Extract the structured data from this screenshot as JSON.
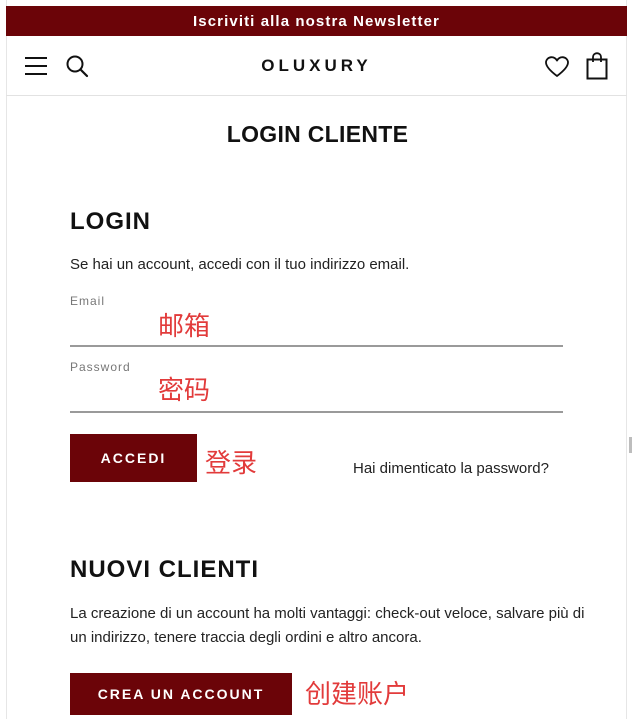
{
  "top_bar": {
    "text": "Iscriviti alla nostra Newsletter"
  },
  "header": {
    "logo": "OLUXURY",
    "icons": [
      "menu-icon",
      "search-icon",
      "heart-icon",
      "shopping-bag-icon"
    ]
  },
  "page_title": "LOGIN CLIENTE",
  "login": {
    "title": "LOGIN",
    "intro": "Se hai un account, accedi con il tuo indirizzo email.",
    "email_label": "Email",
    "password_label": "Password",
    "submit_label": "ACCEDI",
    "forgot_label": "Hai dimenticato la password?"
  },
  "new_customers": {
    "title": "NUOVI CLIENTI",
    "intro": "La creazione di un account ha molti vantaggi: check-out veloce, salvare più di un indirizzo, tenere traccia degli ordini e altro ancora.",
    "create_label": "CREA UN ACCOUNT"
  },
  "annotations": {
    "email": "邮箱",
    "password": "密码",
    "login": "登录",
    "create_account": "创建账户"
  },
  "colors": {
    "brand": "#6b0408",
    "annotation": "#e23b3b"
  }
}
